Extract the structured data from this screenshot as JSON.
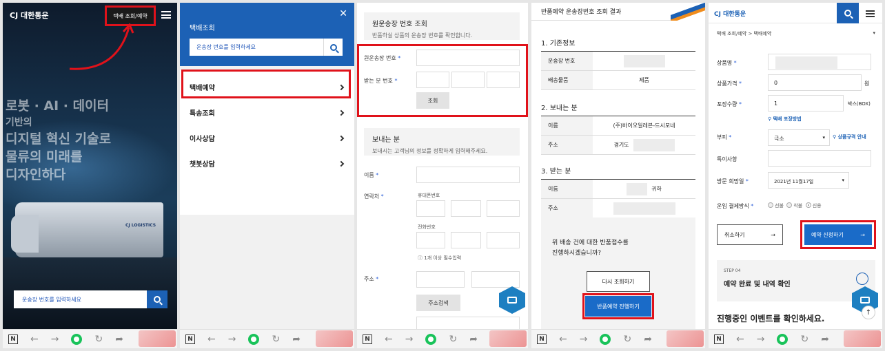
{
  "panel1": {
    "logo": "CJ 대한통운",
    "top_button": "택배 조회/예약",
    "hero_lines": [
      "로봇 · AI · 데이터",
      "기반의",
      "디지털 혁신 기술로",
      "물류의 미래를",
      "디자인하다"
    ],
    "truck_brand": "CJ LOGISTICS",
    "search_placeholder": "운송장 번호를 입력하세요"
  },
  "panel2": {
    "title": "택배조회",
    "search_placeholder": "운송장 번호를 입력하세요",
    "menu": [
      "택배예약",
      "특송조회",
      "이사상담",
      "챗봇상담"
    ]
  },
  "panel3": {
    "section1_title": "원운송장 번호 조회",
    "section1_desc": "반품하실 상품의 운송장 번호를 확인합니다.",
    "tracking_label": "원운송장 번호",
    "receiver_phone_label": "받는 분 번호",
    "lookup_button": "조회",
    "section2_title": "보내는 분",
    "section2_desc": "보내시는 고객님의 정보를 정확하게 입력해주세요.",
    "name_label": "이름",
    "contact_label": "연락처",
    "mobile_label": "휴대폰번호",
    "phone_label": "전화번호",
    "contact_note": "1개 이상 필수입력",
    "address_label": "주소",
    "address_search_button": "주소검색"
  },
  "panel4": {
    "header": "반품예약 운송장번호 조회 결과",
    "sec1": "1. 기존정보",
    "tracking_label": "운송장 번호",
    "item_label": "배송물품",
    "item_value": "제품",
    "sec2": "2. 보내는 분",
    "sender_name_label": "이름",
    "sender_name_value": "(주)바이오일레븐-드시모네",
    "sender_addr_label": "주소",
    "sender_addr_value": "경기도",
    "sec3": "3. 받는 분",
    "recv_name_label": "이름",
    "recv_name_suffix": "귀하",
    "recv_addr_label": "주소",
    "confirm_line1": "위 배송 건에 대한 반품접수를",
    "confirm_line2": "진행하시겠습니까?",
    "retry_button": "다시 조회하기",
    "proceed_button": "반품예약 진행하기"
  },
  "panel5": {
    "logo": "CJ 대한통운",
    "breadcrumb": "택배 조회/예약 > 택배예약",
    "product_name_label": "상품명",
    "price_label": "상품가격",
    "price_value": "0",
    "price_unit": "원",
    "qty_label": "포장수량",
    "qty_value": "1",
    "qty_unit": "박스(BOX)",
    "packing_link": "택배 포장방법",
    "volume_label": "부피",
    "volume_value": "극소",
    "size_link": "상품규격 안내",
    "notes_label": "특이사항",
    "visit_date_label": "방문 희망일",
    "visit_date_value": "2021년 11월17일",
    "payment_label": "운임 결제방식",
    "payment_options": [
      "선불",
      "착불",
      "신용"
    ],
    "cancel_button": "취소하기",
    "submit_button": "예약 신청하기",
    "step_no": "STEP 04",
    "step_title": "예약 완료 및 내역 확인",
    "events_title": "진행중인 이벤트를 확인하세요."
  },
  "colors": {
    "brand_blue": "#1c61b5",
    "highlight_red": "#e0121a"
  },
  "icons": [
    "search-icon",
    "menu-icon",
    "close-icon",
    "chevron-right-icon",
    "chat-icon",
    "arrow-right-icon",
    "back-icon",
    "forward-icon",
    "refresh-icon",
    "share-icon"
  ]
}
